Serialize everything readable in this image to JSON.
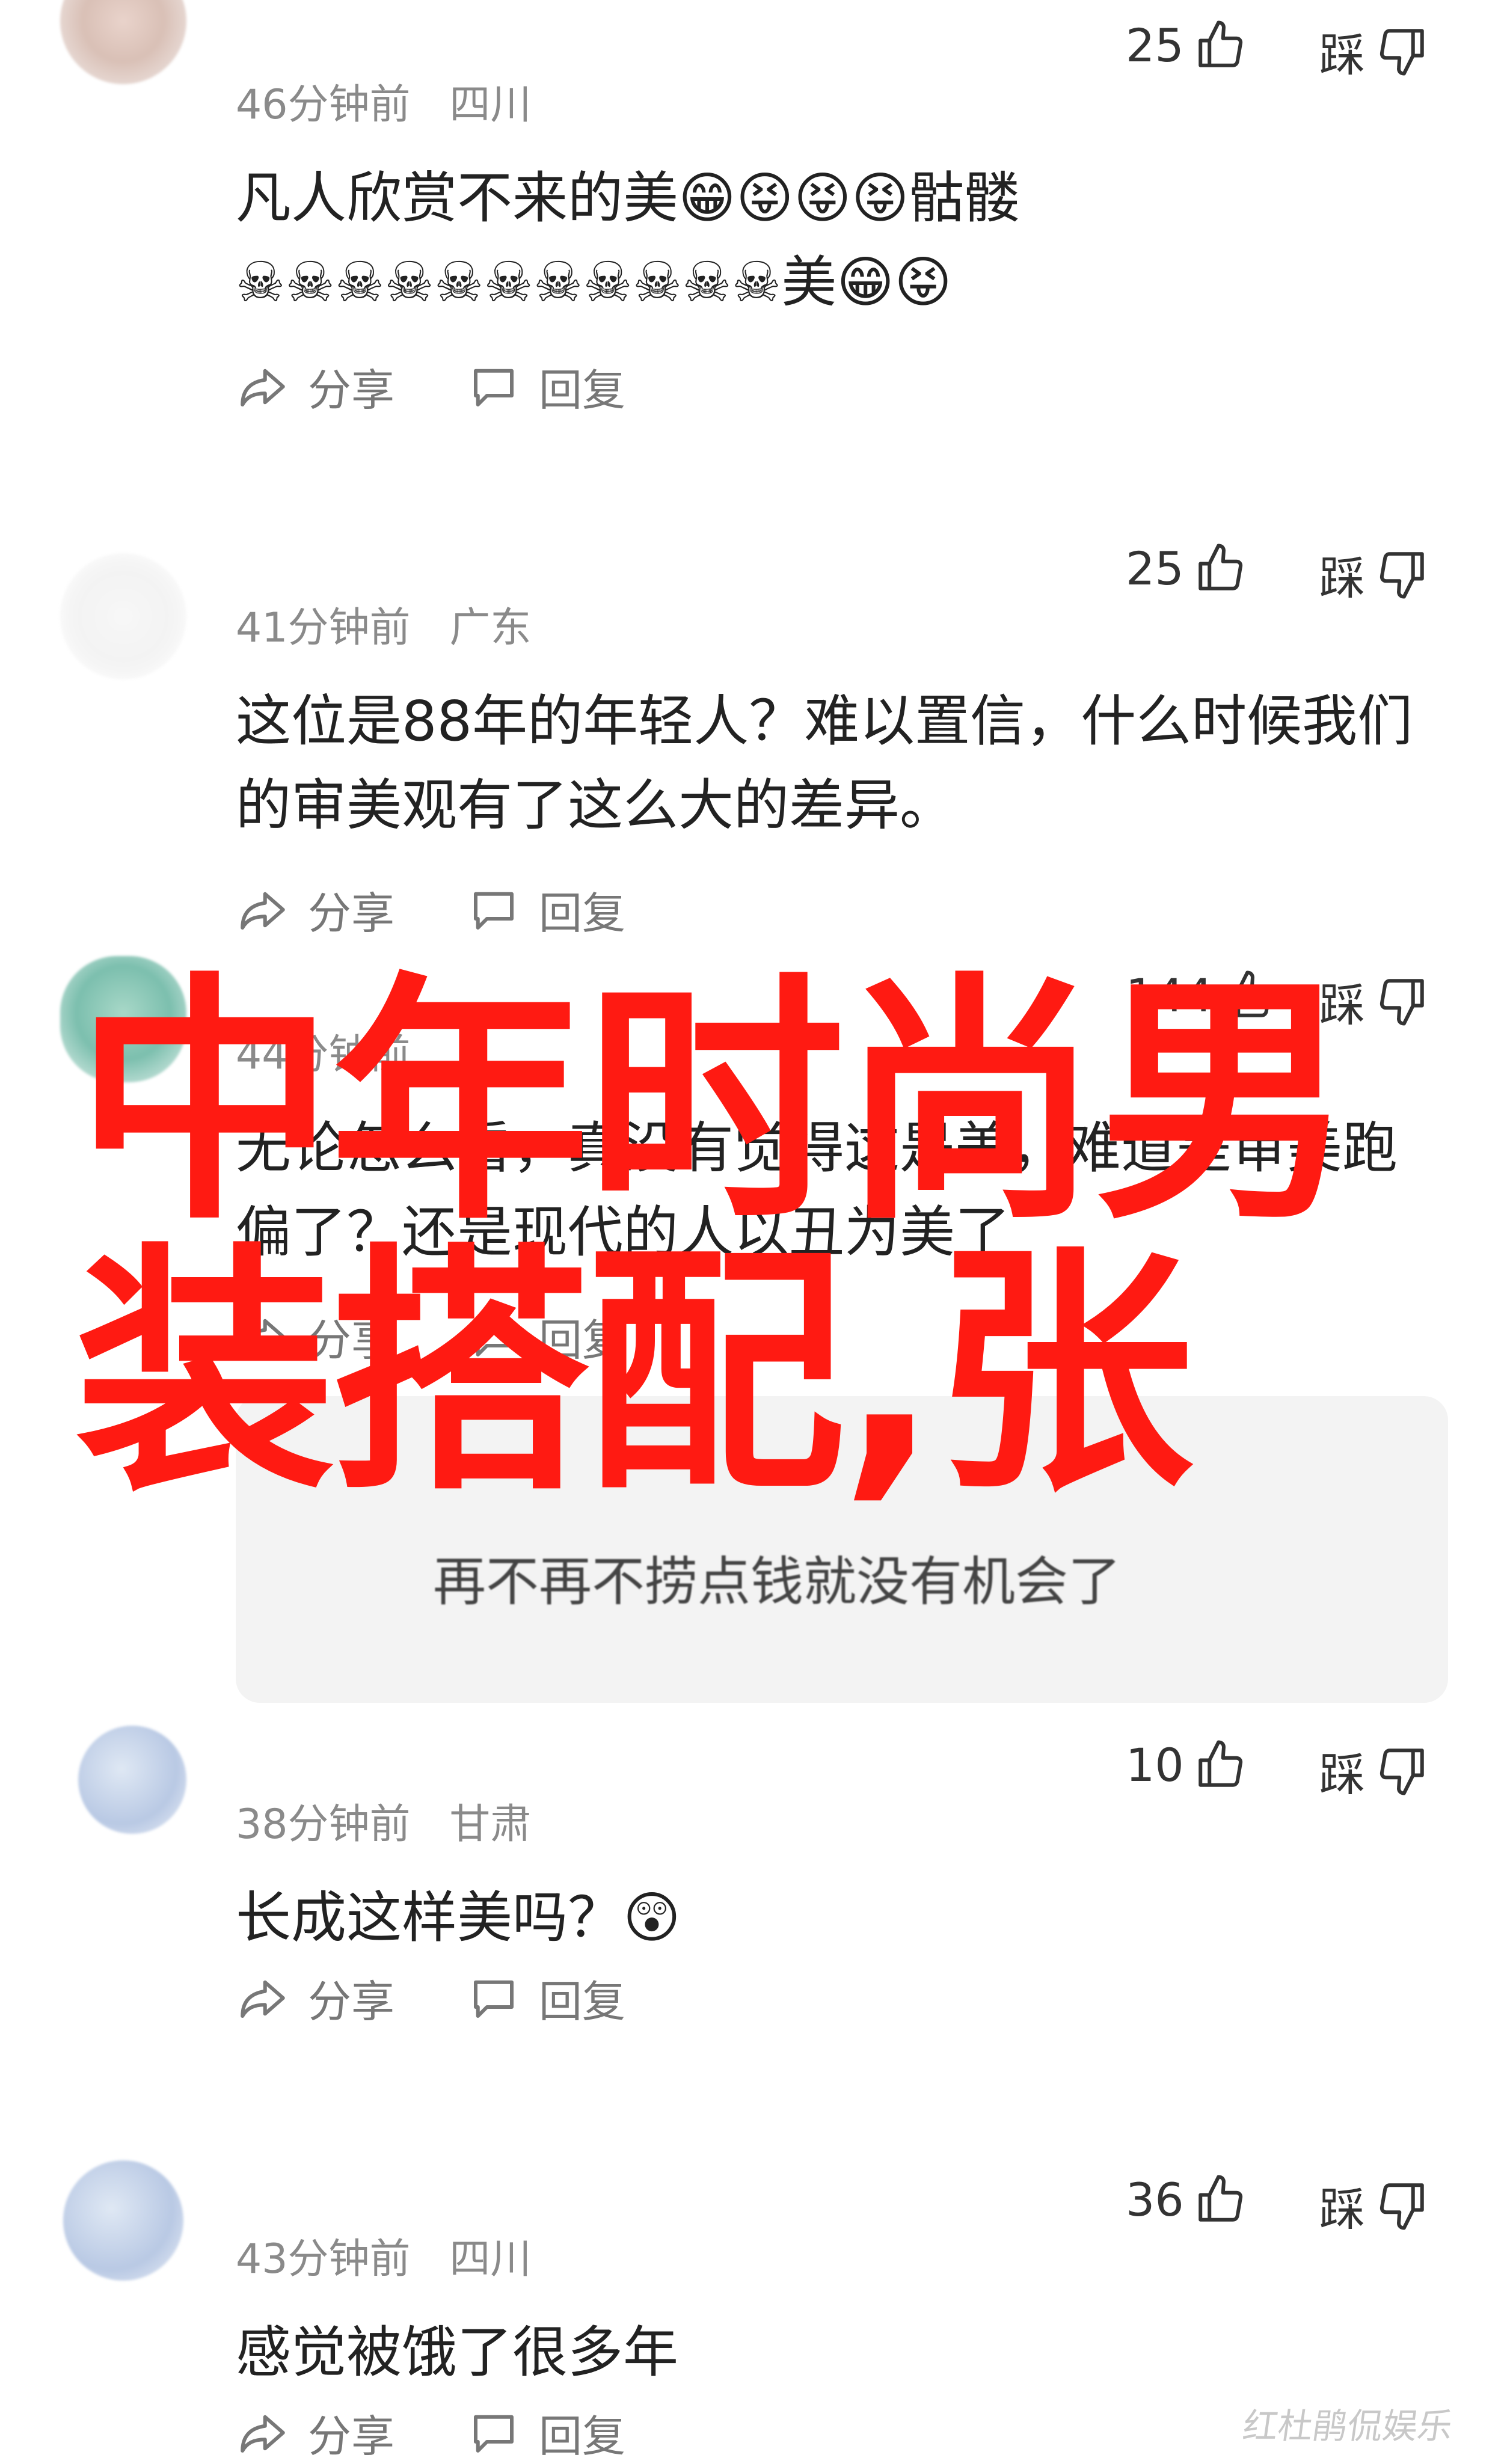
{
  "comments": [
    {
      "time": "46分钟前",
      "location": "四川",
      "text": "凡人欣赏不来的美😁😝😝😝骷髅☠☠☠☠☠☠☠☠☠☠☠美😁😝",
      "likes": "25",
      "dislike_label": "踩",
      "share_label": "分享",
      "reply_label": "回复"
    },
    {
      "time": "41分钟前",
      "location": "广东",
      "text": "这位是88年的年轻人？难以置信，什么时候我们的审美观有了这么大的差异。",
      "likes": "25",
      "dislike_label": "踩",
      "share_label": "分享",
      "reply_label": "回复"
    },
    {
      "time": "44分钟前",
      "location": "",
      "text": "无论怎么看，真没有觉得这是美，难道是审美跑偏了？还是现代的人以丑为美了",
      "likes": "144",
      "dislike_label": "踩",
      "share_label": "分享",
      "reply_label": "回复",
      "quote_line": "再不再不捞点钱就没有机会了"
    },
    {
      "username": "",
      "time": "38分钟前",
      "location": "甘肃",
      "text": "长成这样美吗？😲",
      "likes": "10",
      "dislike_label": "踩",
      "share_label": "分享",
      "reply_label": "回复"
    },
    {
      "username": "",
      "time": "43分钟前",
      "location": "四川",
      "text": "感觉被饿了很多年",
      "likes": "36",
      "dislike_label": "踩",
      "share_label": "分享",
      "reply_label": "回复"
    }
  ],
  "overlay_title": "中年时尚男装搭配,张",
  "watermark": "红杜鹃侃娱乐",
  "colors": {
    "overlay": "#ff1a12",
    "meta": "#8a8a8a"
  },
  "icons": [
    "thumbs-up-icon",
    "thumbs-down-icon",
    "share-icon",
    "reply-icon"
  ]
}
